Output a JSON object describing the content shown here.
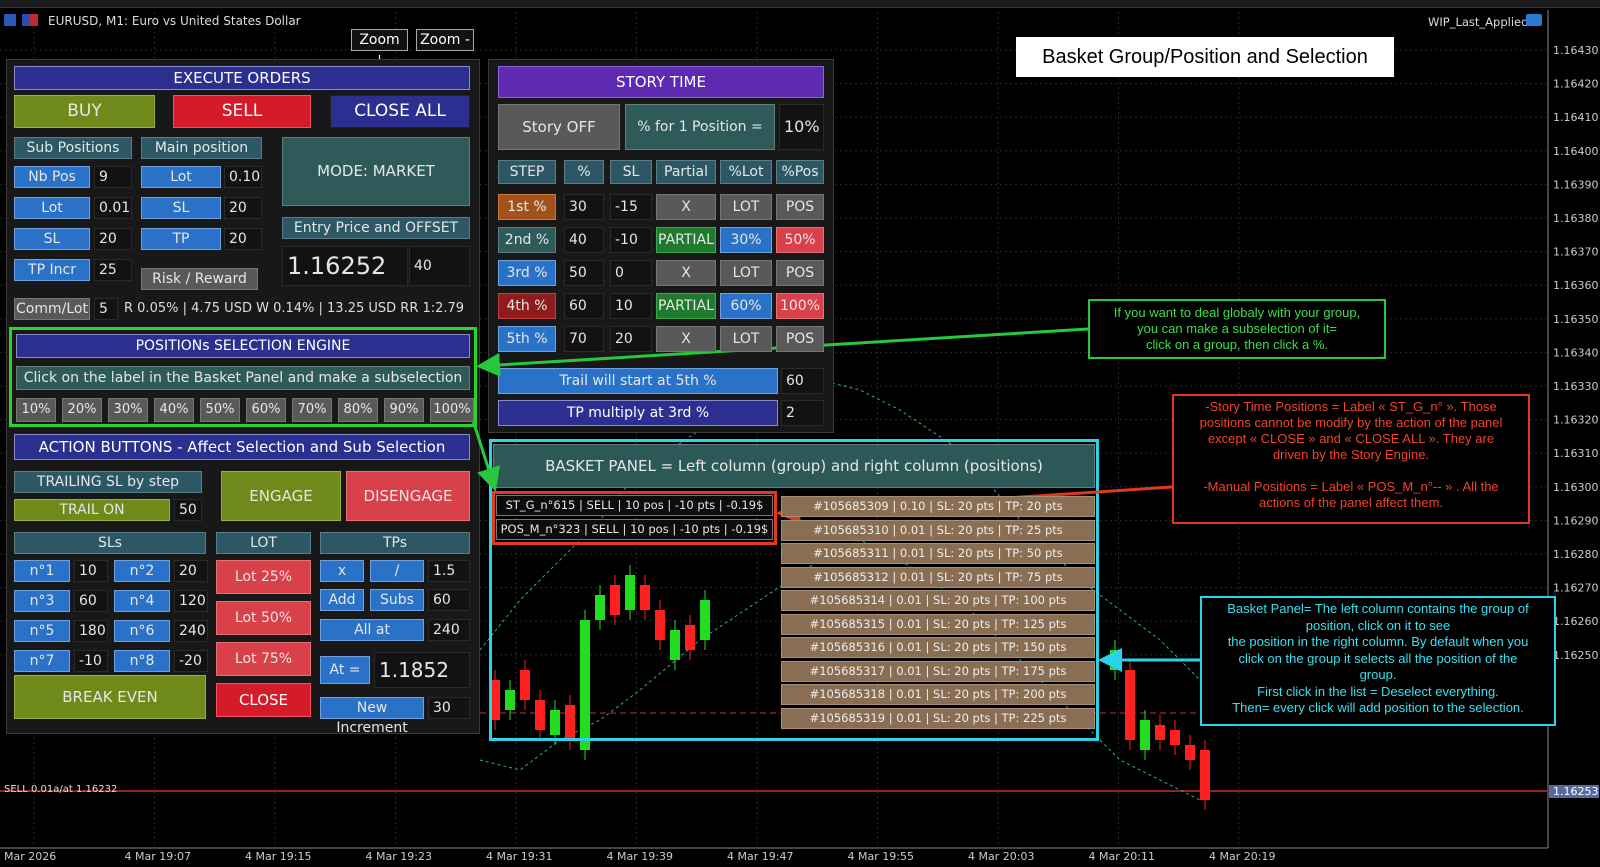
{
  "window": {
    "title": "EURUSD, M1:  Euro vs United States Dollar",
    "indicator": "WIP_Last_Applied",
    "zoom_in": "Zoom +",
    "zoom_out": "Zoom -"
  },
  "heading": "Basket Group/Position and Selection",
  "execute": {
    "title": "EXECUTE ORDERS",
    "buy": "BUY",
    "sell": "SELL",
    "close_all": "CLOSE ALL",
    "sub_positions": "Sub Positions",
    "main_position": "Main position",
    "mode": "MODE: MARKET",
    "nb_pos_label": "Nb Pos",
    "nb_pos_value": "9",
    "sub_lot_label": "Lot",
    "sub_lot_value": "0.01",
    "sub_sl_label": "SL",
    "sub_sl_value": "20",
    "tp_incr_label": "TP Incr",
    "tp_incr_value": "25",
    "main_lot_label": "Lot",
    "main_lot_value": "0.10",
    "main_sl_label": "SL",
    "main_sl_value": "20",
    "main_tp_label": "TP",
    "main_tp_value": "20",
    "entry_label": "Entry Price and OFFSET",
    "entry_price": "1.16252",
    "offset": "40",
    "risk_reward": "Risk / Reward",
    "comm_label": "Comm/Lot",
    "comm_value": "5",
    "rr_text": "R 0.05% | 4.75 USD  W 0.14% | 13.25 USD  RR 1:2.79"
  },
  "selection_engine": {
    "title": "POSITIONs SELECTION ENGINE",
    "hint": "Click on the label in the Basket Panel and make a subselection",
    "percents": [
      "10%",
      "20%",
      "30%",
      "40%",
      "50%",
      "60%",
      "70%",
      "80%",
      "90%",
      "100%"
    ]
  },
  "actions": {
    "title": "ACTION BUTTONS - Affect Selection and Sub Selection",
    "trailing_title": "TRAILING SL by step",
    "trail_on": "TRAIL ON",
    "trail_value": "50",
    "engage": "ENGAGE",
    "disengage": "DISENGAGE",
    "sls_title": "SLs",
    "lot_title": "LOT",
    "tps_title": "TPs",
    "sls": [
      {
        "label": "n°1",
        "value": "10"
      },
      {
        "label": "n°2",
        "value": "20"
      },
      {
        "label": "n°3",
        "value": "60"
      },
      {
        "label": "n°4",
        "value": "120"
      },
      {
        "label": "n°5",
        "value": "180"
      },
      {
        "label": "n°6",
        "value": "240"
      },
      {
        "label": "n°7",
        "value": "-10"
      },
      {
        "label": "n°8",
        "value": "-20"
      }
    ],
    "lots": [
      "Lot 25%",
      "Lot 50%",
      "Lot 75%"
    ],
    "close": "CLOSE",
    "break_even": "BREAK EVEN",
    "tp_mult": "x",
    "tp_div": "/",
    "tp_factor": "1.5",
    "tp_add": "Add",
    "tp_subs": "Subs",
    "tp_step": "60",
    "all_at": "All at",
    "all_at_value": "240",
    "at_eq": "At =",
    "at_value": "1.1852",
    "new_increment": "New Increment",
    "new_increment_value": "30"
  },
  "story": {
    "title": "STORY TIME",
    "story_off": "Story OFF",
    "pct_label": "% for 1 Position =",
    "pct_value": "10%",
    "headers": [
      "STEP",
      "%",
      "SL",
      "Partial",
      "%Lot",
      "%Pos"
    ],
    "rows": [
      {
        "step": "1st %",
        "pct": "30",
        "sl": "-15",
        "partial": "X",
        "lot": "LOT",
        "pos": "POS"
      },
      {
        "step": "2nd %",
        "pct": "40",
        "sl": "-10",
        "partial": "PARTIAL",
        "lot": "30%",
        "pos": "50%"
      },
      {
        "step": "3rd %",
        "pct": "50",
        "sl": "0",
        "partial": "X",
        "lot": "LOT",
        "pos": "POS"
      },
      {
        "step": "4th %",
        "pct": "60",
        "sl": "10",
        "partial": "PARTIAL",
        "lot": "60%",
        "pos": "100%"
      },
      {
        "step": "5th %",
        "pct": "70",
        "sl": "20",
        "partial": "X",
        "lot": "LOT",
        "pos": "POS"
      }
    ],
    "trail_label": "Trail will start at 5th %",
    "trail_value": "60",
    "tp_multiply_label": "TP multiply at 3rd %",
    "tp_multiply_value": "2"
  },
  "basket": {
    "title": "BASKET PANEL = Left column (group) and right column (positions)",
    "groups": [
      "ST_G_n°615 | SELL | 10 pos | -10 pts | -0.19$",
      "POS_M_n°323 | SELL | 10 pos | -10 pts | -0.19$"
    ],
    "positions": [
      "#105685309 | 0.10 | SL: 20 pts | TP: 20 pts",
      "#105685310 | 0.01 | SL: 20 pts | TP: 25 pts",
      "#105685311 | 0.01 | SL: 20 pts | TP: 50 pts",
      "#105685312 | 0.01 | SL: 20 pts | TP: 75 pts",
      "#105685314 | 0.01 | SL: 20 pts | TP: 100 pts",
      "#105685315 | 0.01 | SL: 20 pts | TP: 125 pts",
      "#105685316 | 0.01 | SL: 20 pts | TP: 150 pts",
      "#105685317 | 0.01 | SL: 20 pts | TP: 175 pts",
      "#105685318 | 0.01 | SL: 20 pts | TP: 200 pts",
      "#105685319 | 0.01 | SL: 20 pts | TP: 225 pts"
    ]
  },
  "callouts": {
    "green": [
      "If you want to deal globaly with your group,",
      "you can make a subselection of it=",
      "click on a group, then click a %."
    ],
    "red": [
      "-Story Time Positions = Label « ST_G_n° ». Those",
      "positions cannot be modify by the action of the panel",
      "except « CLOSE » and « CLOSE ALL ». They are",
      "driven by the Story Engine.",
      "",
      "-Manual Positions = Label « POS_M_n°-- » . All the",
      "actions of the panel affect them."
    ],
    "cyan": [
      "Basket Panel=  The left column contains the group of",
      "position, click on it to see",
      "the position in the right column. By default when you",
      "click on the group it selects all the position of the",
      "group.",
      "First click in the list = Deselect everything.",
      "Then= every click will add position to the selection."
    ]
  },
  "chart": {
    "price_labels": [
      "1.16430",
      "1.16420",
      "1.16410",
      "1.16400",
      "1.16390",
      "1.16380",
      "1.16370",
      "1.16360",
      "1.16350",
      "1.16340",
      "1.16330",
      "1.16320",
      "1.16310",
      "1.16300",
      "1.16290",
      "1.16280",
      "1.16270",
      "1.16260",
      "1.16250"
    ],
    "current_price": "1.16253",
    "sell_line": "SELL 0.01a/at 1.16232",
    "time_labels": [
      "Mar 2026",
      "4 Mar 19:07",
      "4 Mar 19:15",
      "4 Mar 19:23",
      "4 Mar 19:31",
      "4 Mar 19:39",
      "4 Mar 19:47",
      "4 Mar 19:55",
      "4 Mar 20:03",
      "4 Mar 20:11",
      "4 Mar 20:19"
    ]
  }
}
